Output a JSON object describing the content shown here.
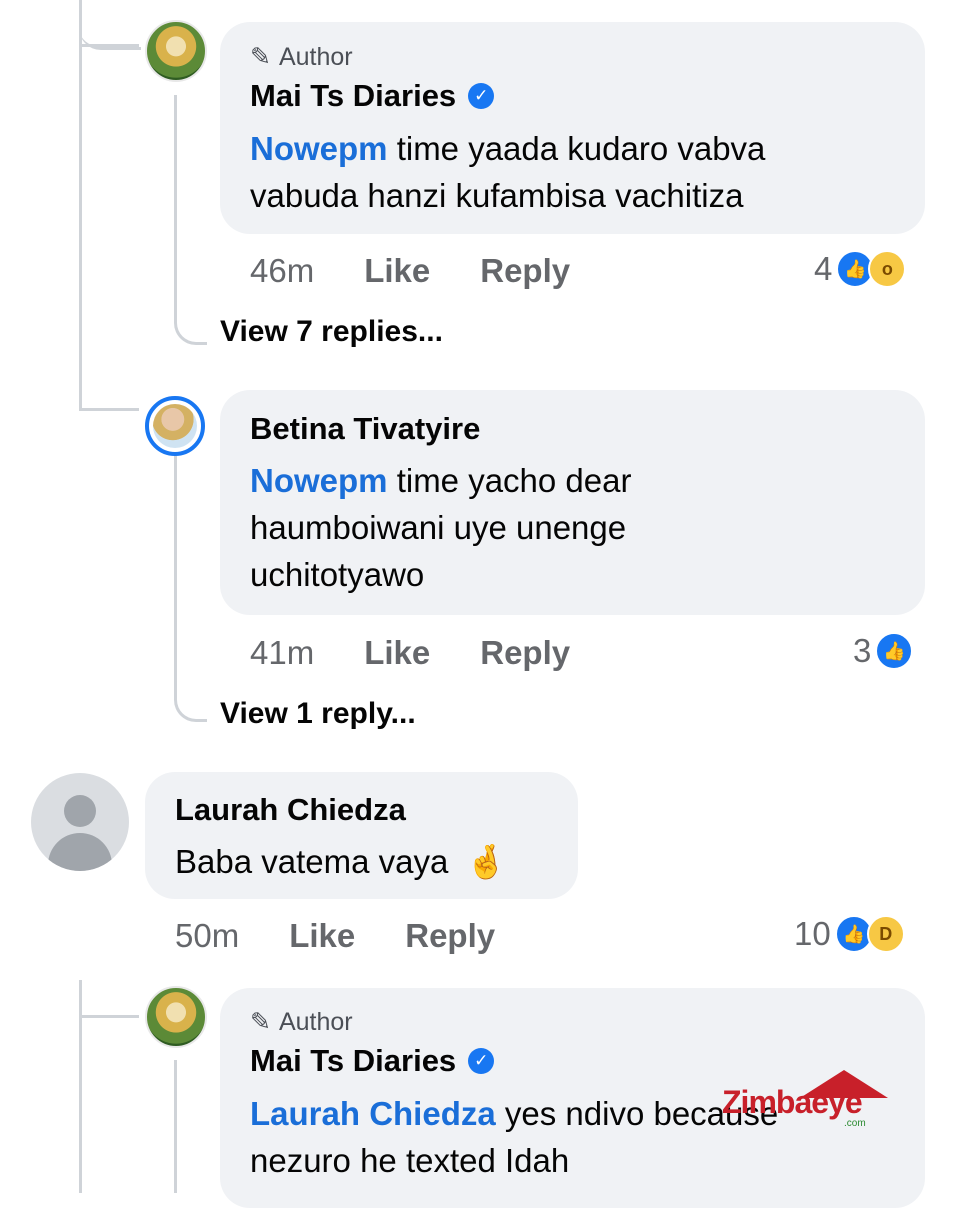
{
  "comments": [
    {
      "is_author": true,
      "author_tag": "Author",
      "name": "Mai Ts Diaries",
      "verified": true,
      "mention": "Nowepm",
      "text_lines": [
        "time yaada kudaro vabva",
        "vabuda hanzi kufambisa vachitiza"
      ],
      "time": "46m",
      "like_label": "Like",
      "reply_label": "Reply",
      "reaction_count": "4",
      "reactions": [
        "like-icon",
        "wow-icon"
      ],
      "view_replies": "View 7 replies..."
    },
    {
      "is_author": false,
      "name": "Betina Tivatyire",
      "mention": "Nowepm",
      "text_lines": [
        "time yacho dear",
        "haumboiwani uye unenge",
        "uchitotyawo"
      ],
      "time": "41m",
      "like_label": "Like",
      "reply_label": "Reply",
      "reaction_count": "3",
      "reactions": [
        "like-icon"
      ],
      "view_replies": "View 1 reply..."
    },
    {
      "is_author": false,
      "name": "Laurah Chiedza",
      "text_lines": [
        "Baba vatema vaya"
      ],
      "emoji": "🤞",
      "time": "50m",
      "like_label": "Like",
      "reply_label": "Reply",
      "reaction_count": "10",
      "reactions": [
        "like-icon",
        "haha-icon"
      ]
    },
    {
      "is_author": true,
      "author_tag": "Author",
      "name": "Mai Ts Diaries",
      "verified": true,
      "mention": "Laurah Chiedza",
      "text_lines": [
        "yes ndivo because",
        "nezuro he texted Idah"
      ]
    }
  ],
  "watermark": {
    "text": "Zimbaeye",
    "sub": ".com"
  },
  "colors": {
    "accent": "#1877f2",
    "mention": "#1a6ed8",
    "bubble": "#f0f2f5",
    "meta": "#65676b"
  }
}
